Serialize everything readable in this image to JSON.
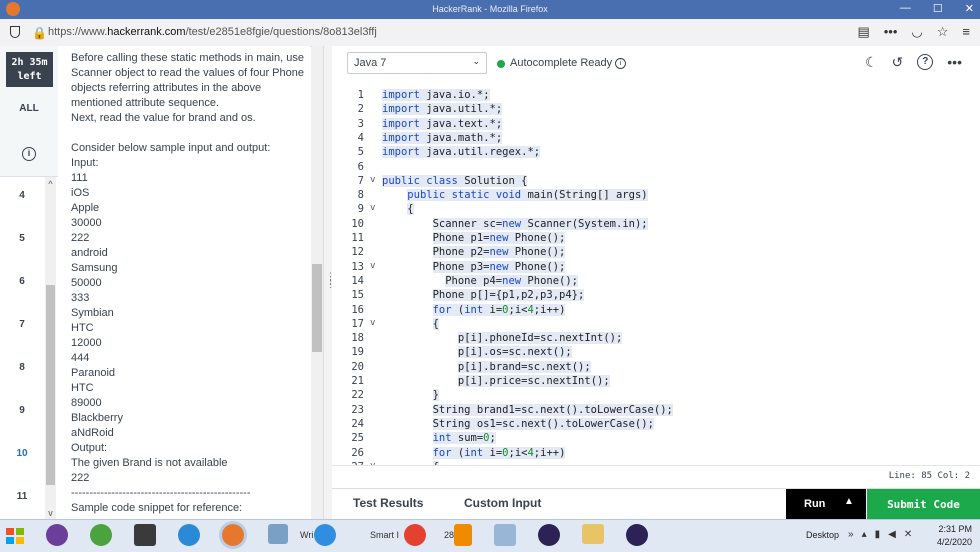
{
  "window": {
    "title": "HackerRank - Mozilla Firefox",
    "controls": [
      "—",
      "☐",
      "✕"
    ]
  },
  "browser": {
    "url_prefix": "https://www.",
    "url_host": "hackerrank.com",
    "url_path": "/test/e2851e8fgie/questions/8o813el3ffj",
    "toolbar_icons": [
      "reader-icon",
      "more-icon",
      "pocket-icon",
      "bookmark-star-icon"
    ]
  },
  "sidebar": {
    "timer_line1": "2h 35m",
    "timer_line2": "left",
    "all_label": "ALL",
    "info_symbol": "i",
    "questions": [
      "4",
      "5",
      "6",
      "7",
      "8",
      "9",
      "10",
      "11"
    ],
    "current_question": "10"
  },
  "problem": {
    "lines": [
      "Before calling these static methods in main, use",
      "Scanner object to read the values of four Phone",
      "objects referring attributes in the above",
      "mentioned attribute sequence.",
      "Next, read the value for brand and os.",
      "",
      "Consider below sample input and output:",
      "Input:",
      "111",
      "iOS",
      "Apple",
      "30000",
      "222",
      "android",
      "Samsung",
      "50000",
      "333",
      "Symbian",
      "HTC",
      "12000",
      "444",
      "Paranoid",
      "HTC",
      "89000",
      "Blackberry",
      "aNdRoid",
      "Output:",
      "The given Brand is not available",
      "222",
      "-------------------------------------------------",
      "Sample code snippet for reference:"
    ]
  },
  "editor": {
    "language": "Java 7",
    "autocomplete_label": "Autocomplete Ready",
    "status_line": "Line: 85 Col: 2",
    "code": [
      {
        "n": "1",
        "fold": "",
        "indent": "",
        "text": "import java.io.*;"
      },
      {
        "n": "2",
        "fold": "",
        "indent": "",
        "text": "import java.util.*;"
      },
      {
        "n": "3",
        "fold": "",
        "indent": "",
        "text": "import java.text.*;"
      },
      {
        "n": "4",
        "fold": "",
        "indent": "",
        "text": "import java.math.*;"
      },
      {
        "n": "5",
        "fold": "",
        "indent": "",
        "text": "import java.util.regex.*;"
      },
      {
        "n": "6",
        "fold": "",
        "indent": "",
        "text": ""
      },
      {
        "n": "7",
        "fold": "v",
        "indent": "",
        "text": "public class Solution {"
      },
      {
        "n": "8",
        "fold": "",
        "indent": "    ",
        "text": "public static void main(String[] args)"
      },
      {
        "n": "9",
        "fold": "v",
        "indent": "    ",
        "text": "{"
      },
      {
        "n": "10",
        "fold": "",
        "indent": "        ",
        "text": "Scanner sc=new Scanner(System.in);"
      },
      {
        "n": "11",
        "fold": "",
        "indent": "        ",
        "text": "Phone p1=new Phone();"
      },
      {
        "n": "12",
        "fold": "",
        "indent": "        ",
        "text": "Phone p2=new Phone();"
      },
      {
        "n": "13",
        "fold": "v",
        "indent": "        ",
        "text": "Phone p3=new Phone();"
      },
      {
        "n": "14",
        "fold": "",
        "indent": "          ",
        "text": "Phone p4=new Phone();"
      },
      {
        "n": "15",
        "fold": "",
        "indent": "        ",
        "text": "Phone p[]={p1,p2,p3,p4};"
      },
      {
        "n": "16",
        "fold": "",
        "indent": "        ",
        "text": "for (int i=0;i<4;i++)"
      },
      {
        "n": "17",
        "fold": "v",
        "indent": "        ",
        "text": "{"
      },
      {
        "n": "18",
        "fold": "",
        "indent": "            ",
        "text": "p[i].phoneId=sc.nextInt();"
      },
      {
        "n": "19",
        "fold": "",
        "indent": "            ",
        "text": "p[i].os=sc.next();"
      },
      {
        "n": "20",
        "fold": "",
        "indent": "            ",
        "text": "p[i].brand=sc.next();"
      },
      {
        "n": "21",
        "fold": "",
        "indent": "            ",
        "text": "p[i].price=sc.nextInt();"
      },
      {
        "n": "22",
        "fold": "",
        "indent": "        ",
        "text": "}"
      },
      {
        "n": "23",
        "fold": "",
        "indent": "        ",
        "text": "String brand1=sc.next().toLowerCase();"
      },
      {
        "n": "24",
        "fold": "",
        "indent": "        ",
        "text": "String os1=sc.next().toLowerCase();"
      },
      {
        "n": "25",
        "fold": "",
        "indent": "        ",
        "text": "int sum=0;"
      },
      {
        "n": "26",
        "fold": "",
        "indent": "        ",
        "text": "for (int i=0;i<4;i++)"
      },
      {
        "n": "27",
        "fold": "v",
        "indent": "        ",
        "text": "{"
      }
    ]
  },
  "bottom": {
    "test_results": "Test Results",
    "custom_input": "Custom Input",
    "run": "Run",
    "submit": "Submit Code"
  },
  "taskbar": {
    "apps": [
      "start-orb",
      "tor-browser",
      "utorrent",
      "sublime-text",
      "internet-explorer",
      "firefox",
      "folder",
      "wrl",
      "smart",
      "chrome",
      "vlc",
      "snipping-tool",
      "eclipse",
      "file-explorer",
      "eclipse-2"
    ],
    "labels": {
      "wri": "Wri",
      "smart": "Smart I",
      "num": "28"
    },
    "desktop_label": "Desktop",
    "time": "2:31 PM",
    "date": "4/2/2020",
    "colors": {
      "taskbar": "#dfe8f3",
      "accent_green": "#1ba94c",
      "timer_bg": "#39424e"
    }
  }
}
